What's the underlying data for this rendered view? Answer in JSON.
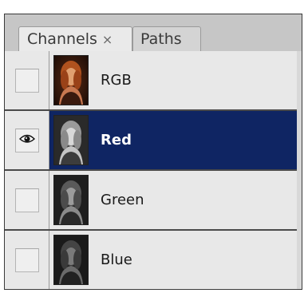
{
  "tabs": [
    {
      "label": "Channels",
      "active": true,
      "close_glyph": "×"
    },
    {
      "label": "Paths",
      "active": false
    }
  ],
  "channels": [
    {
      "label": "RGB",
      "visible": false,
      "selected": false,
      "thumb_icon": "portrait-color-thumbnail"
    },
    {
      "label": "Red",
      "visible": true,
      "selected": true,
      "thumb_icon": "portrait-grayscale-thumbnail"
    },
    {
      "label": "Green",
      "visible": false,
      "selected": false,
      "thumb_icon": "portrait-grayscale-thumbnail"
    },
    {
      "label": "Blue",
      "visible": false,
      "selected": false,
      "thumb_icon": "portrait-grayscale-thumbnail"
    }
  ],
  "colors": {
    "selected_row": "#0f2563",
    "panel_bg": "#e8e8e8",
    "tabbar_bg": "#c6c6c6"
  }
}
